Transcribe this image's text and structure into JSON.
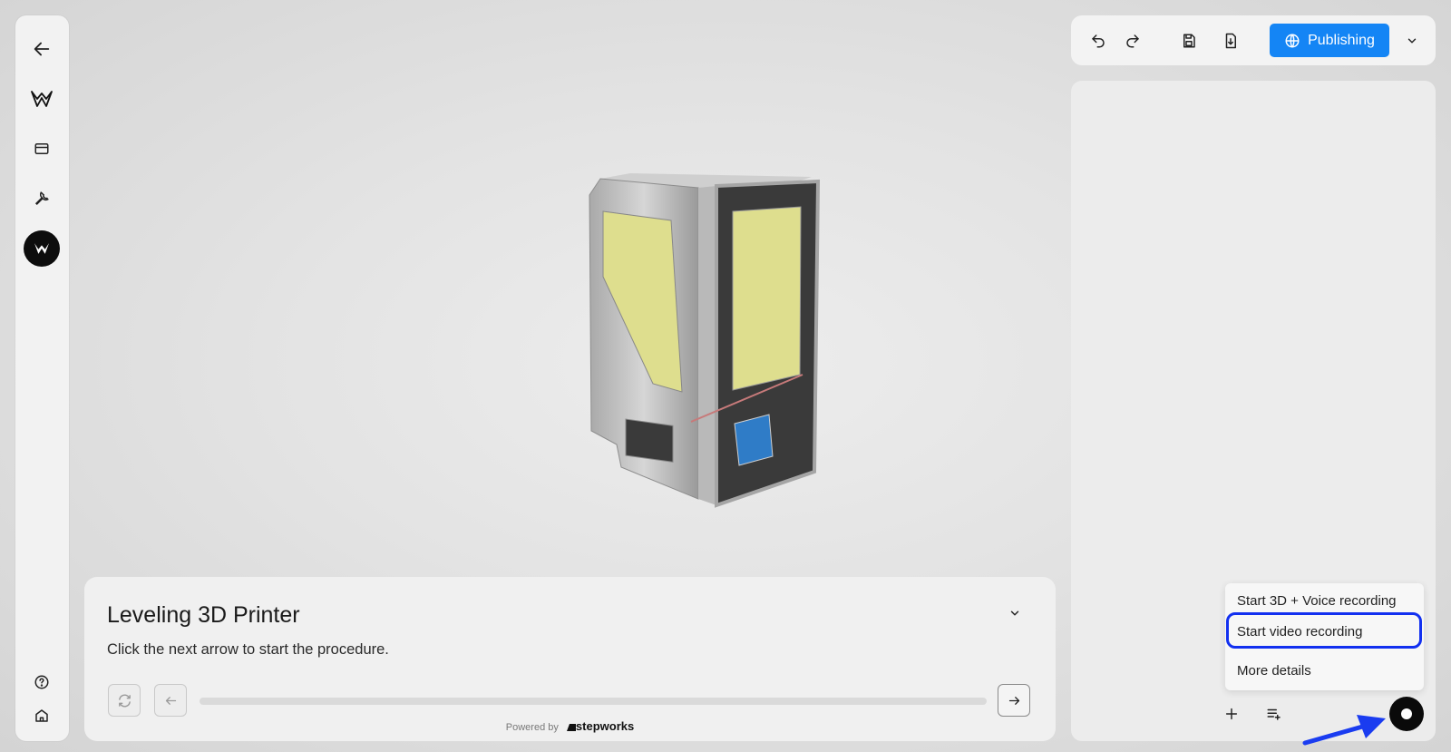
{
  "sidebar": {
    "items": [
      {
        "icon": "arrow-left-icon"
      },
      {
        "icon": "brand-logo-icon"
      },
      {
        "icon": "card-icon"
      },
      {
        "icon": "wrench-icon"
      },
      {
        "icon": "brand-logo-active-icon"
      }
    ],
    "footer": [
      {
        "icon": "help-circle-icon"
      },
      {
        "icon": "home-icon"
      }
    ]
  },
  "toolbar": {
    "icons": [
      "undo-icon",
      "redo-icon",
      "save-icon",
      "download-icon"
    ],
    "publish_label": "Publishing",
    "publish_color": "#1485f5"
  },
  "recording_menu": {
    "items": [
      "Start 3D + Voice recording",
      "Start video recording",
      "More details"
    ],
    "highlighted_index": 1,
    "highlight_color": "#1230f0"
  },
  "procedure": {
    "title": "Leveling 3D Printer",
    "subtitle": "Click the next arrow to start the procedure.",
    "progress": 0
  },
  "footer": {
    "powered_by": "Powered by",
    "brand": "stepworks"
  }
}
